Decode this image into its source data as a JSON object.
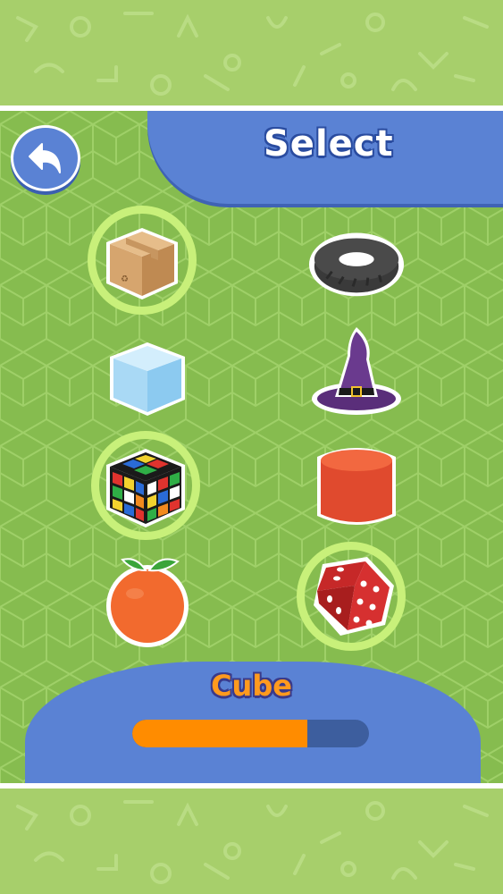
{
  "header": {
    "title": "Select"
  },
  "back_button": {
    "icon": "back-arrow-icon"
  },
  "items": [
    {
      "id": "cardboard-box",
      "icon": "cardboard-box-icon",
      "selected": true
    },
    {
      "id": "tire",
      "icon": "tire-icon",
      "selected": false
    },
    {
      "id": "ice-cube",
      "icon": "ice-cube-icon",
      "selected": false
    },
    {
      "id": "witch-hat",
      "icon": "witch-hat-icon",
      "selected": false
    },
    {
      "id": "rubiks-cube",
      "icon": "rubiks-cube-icon",
      "selected": true
    },
    {
      "id": "cylinder",
      "icon": "cylinder-icon",
      "selected": false
    },
    {
      "id": "orange",
      "icon": "orange-icon",
      "selected": false
    },
    {
      "id": "dice",
      "icon": "dice-icon",
      "selected": true
    }
  ],
  "answer": {
    "label": "Cube"
  },
  "progress": {
    "fraction": 0.74
  },
  "colors": {
    "panel_blue": "#5a82d4",
    "selection_ring": "#c8f07a",
    "progress_fill": "#ff8c00",
    "progress_track": "#3d5e9e",
    "answer_text": "#ff9a1e"
  }
}
